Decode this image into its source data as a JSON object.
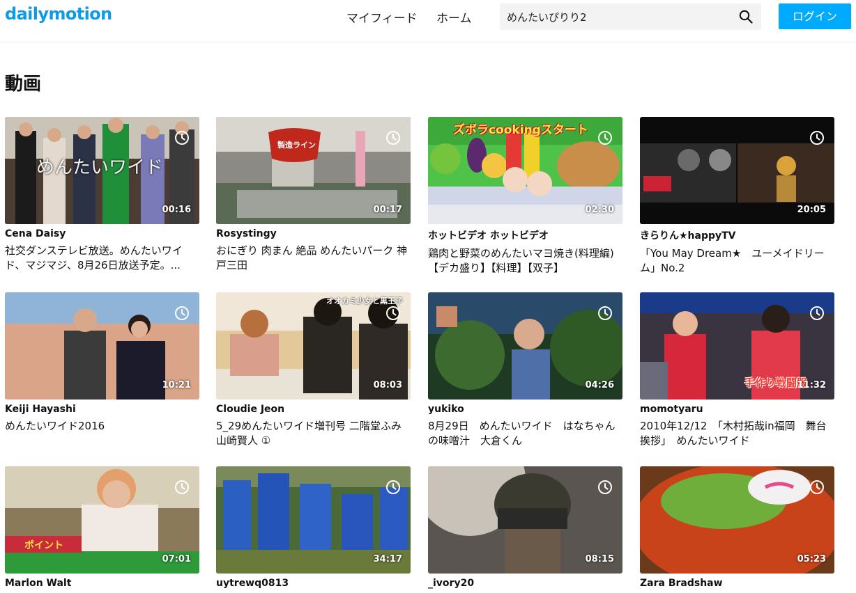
{
  "header": {
    "logo": "dailymotion",
    "nav": {
      "my_feed": "マイフィード",
      "home": "ホーム"
    },
    "search": {
      "value": "めんたいぴりり2",
      "icon": "search-icon"
    },
    "login_label": "ログイン"
  },
  "colors": {
    "brand": "#0e9be6",
    "login_button": "#00aaff"
  },
  "section_title": "動画",
  "videos": [
    {
      "channel": "Cena Daisy",
      "title": "社交ダンステレビ放送。めんたいワイド、マジマジ、8月26日放送予定。...",
      "duration": "00:16",
      "overlay": "めんたいワイド"
    },
    {
      "channel": "Rosystingy",
      "title": "おにぎり 肉まん 絶品 めんたいパーク 神戸三田",
      "duration": "00:17",
      "overlay": "製造ライン"
    },
    {
      "channel": "ホットビデオ ホットビデオ",
      "title": "鶏肉と野菜のめんたいマヨ焼き(料理編)【デカ盛り】【料理】【双子】",
      "duration": "02:30",
      "overlay": "ズボラcookingスタート"
    },
    {
      "channel": "きらりん★happyTV",
      "title": "「You May Dream★　ユーメイドリーム」No.2",
      "duration": "20:05",
      "overlay": ""
    },
    {
      "channel": "Keiji Hayashi",
      "title": "めんたいワイド2016",
      "duration": "10:21",
      "overlay": ""
    },
    {
      "channel": "Cloudie Jeon",
      "title": "5_29めんたいワイド増刊号 二階堂ふみ 山崎賢人 ①",
      "duration": "08:03",
      "overlay": "オオカミ少女と黒王子"
    },
    {
      "channel": "yukiko",
      "title": "8月29日　めんたいワイド　はなちゃんの味噌汁　大倉くん",
      "duration": "04:26",
      "overlay": ""
    },
    {
      "channel": "momotyaru",
      "title": "2010年12/12　「木村拓哉in福岡　舞台挨拶」　めんたいワイド",
      "duration": "11:32",
      "overlay": "手作り戦闘服"
    },
    {
      "channel": "Marlon Walt",
      "title": "",
      "duration": "07:01",
      "overlay": "ポイント"
    },
    {
      "channel": "uytrewq0813",
      "title": "",
      "duration": "34:17",
      "overlay": ""
    },
    {
      "channel": "_ivory20",
      "title": "",
      "duration": "08:15",
      "overlay": ""
    },
    {
      "channel": "Zara Bradshaw",
      "title": "",
      "duration": "05:23",
      "overlay": ""
    }
  ]
}
